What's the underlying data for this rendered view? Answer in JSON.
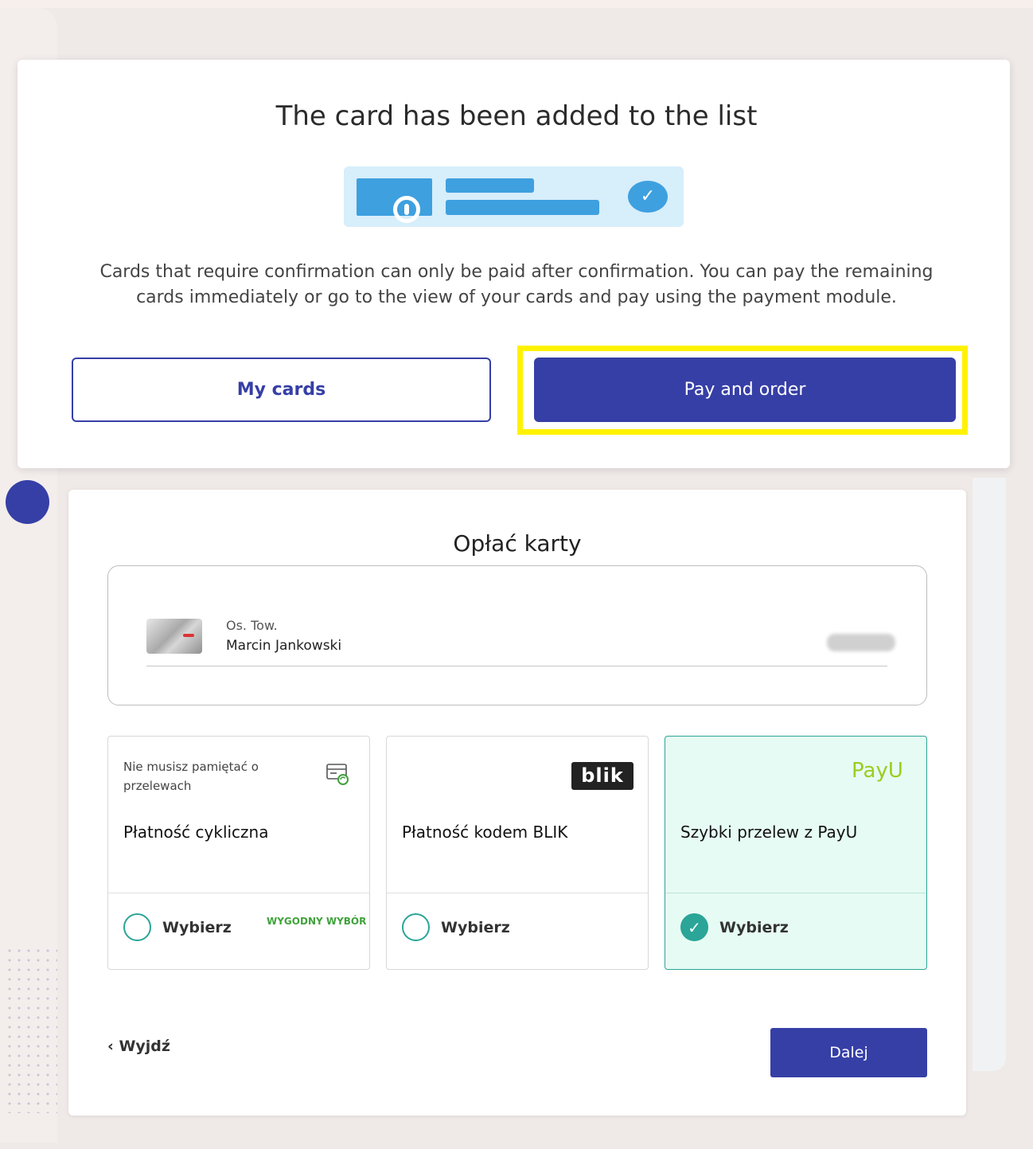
{
  "modal": {
    "title": "The card has been added to the list",
    "message": "Cards that require confirmation can only be paid after confirmation. You can pay the remaining cards immediately or go to the view of your cards and pay using the payment module.",
    "my_cards_label": "My cards",
    "pay_label": "Pay and order"
  },
  "payment": {
    "title": "Opłać karty",
    "card": {
      "type": "Os. Tow.",
      "holder": "Marcin Jankowski"
    },
    "options": [
      {
        "subtitle": "Nie musisz pamiętać o przelewach",
        "name": "Płatność cykliczna",
        "choose": "Wybierz",
        "tag": "WYGODNY WYBÓR",
        "selected": false
      },
      {
        "logo": "blik",
        "name": "Płatność kodem BLIK",
        "choose": "Wybierz",
        "selected": false
      },
      {
        "logo": "PayU",
        "name": "Szybki przelew z PayU",
        "choose": "Wybierz",
        "selected": true
      }
    ],
    "exit_label": "Wyjdź",
    "next_label": "Dalej"
  },
  "colors": {
    "primary": "#363fa6",
    "accent_teal": "#2aa597",
    "highlight": "#fff200",
    "selected_bg": "#e6fbf3"
  }
}
